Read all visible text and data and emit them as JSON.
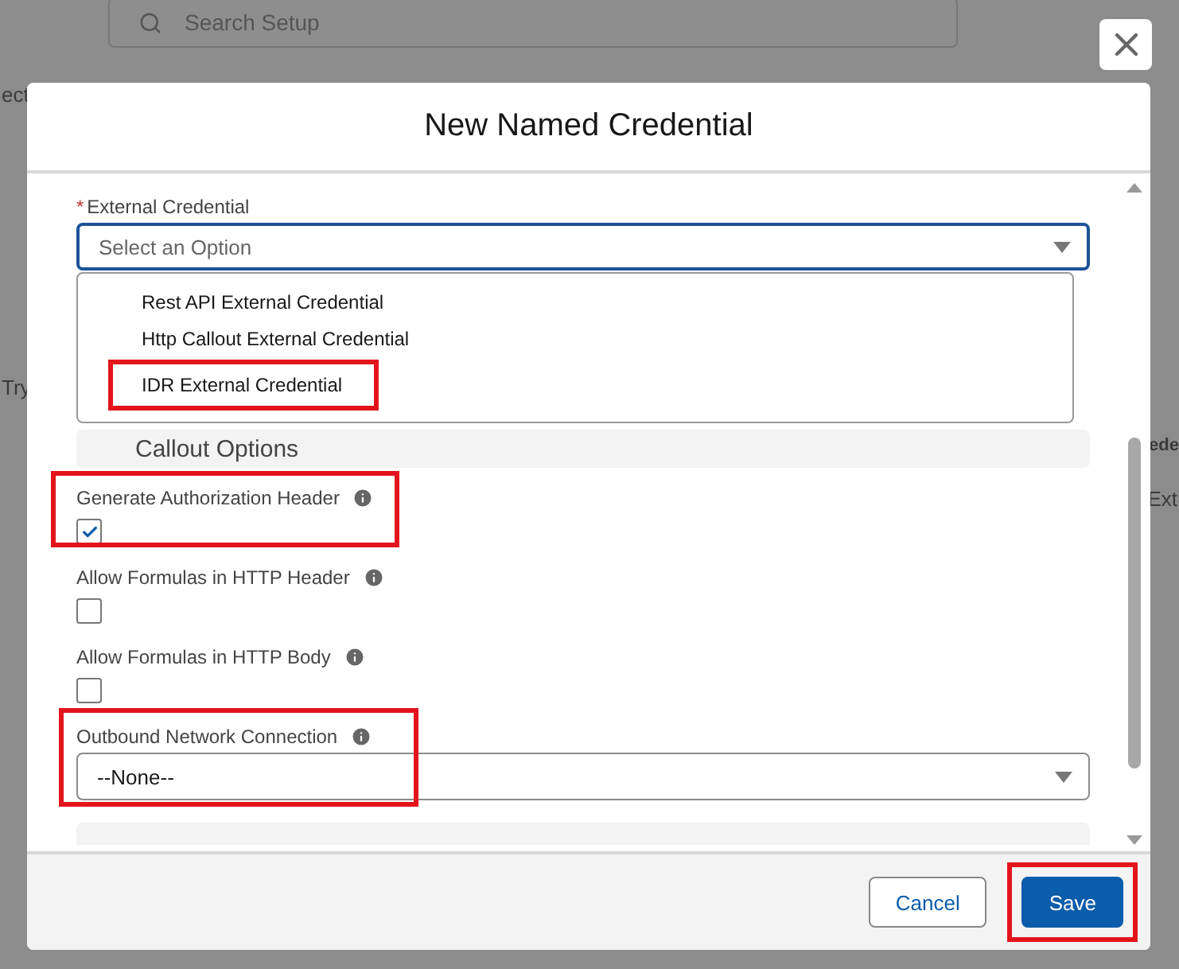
{
  "background": {
    "search_placeholder": "Search Setup",
    "fragments": [
      "ect",
      "Try",
      "ede",
      "Ext"
    ]
  },
  "modal": {
    "title": "New Named Credential"
  },
  "external_credential": {
    "label": "External Credential",
    "required_mark": "*",
    "placeholder": "Select an Option",
    "expanded": true,
    "options": [
      {
        "label": "Rest API External Credential",
        "highlighted": false
      },
      {
        "label": "Http Callout External Credential",
        "highlighted": false
      },
      {
        "label": "IDR External Credential",
        "highlighted": true
      }
    ]
  },
  "section": {
    "title": "Callout Options"
  },
  "checkboxes": [
    {
      "label": "Generate Authorization Header",
      "checked": true,
      "highlighted": true
    },
    {
      "label": "Allow Formulas in HTTP Header",
      "checked": false,
      "highlighted": false
    },
    {
      "label": "Allow Formulas in HTTP Body",
      "checked": false,
      "highlighted": false
    }
  ],
  "outbound": {
    "label": "Outbound Network Connection",
    "value": "--None--",
    "highlighted": true
  },
  "buttons": [
    {
      "label": "Cancel",
      "kind": "neutral",
      "highlighted": false
    },
    {
      "label": "Save",
      "kind": "brand",
      "highlighted": true
    }
  ]
}
